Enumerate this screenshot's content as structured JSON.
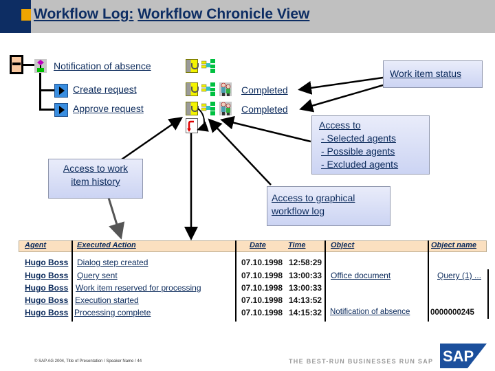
{
  "header": {
    "title_part1": "Workflow Log:",
    "title_part2": "Workflow Chronicle View"
  },
  "tree": {
    "root": {
      "label": "Notification of absence",
      "icons": [
        "status-icon",
        "graph-icon"
      ]
    },
    "children": [
      {
        "label": "Create request",
        "status": "Completed",
        "icons": [
          "status-icon",
          "graph-icon",
          "agents-icon"
        ]
      },
      {
        "label": "Approve request",
        "status": "Completed",
        "icons": [
          "status-icon",
          "graph-icon",
          "agents-icon"
        ]
      }
    ]
  },
  "callouts": {
    "work_item_status": "Work item status",
    "access_agents": {
      "title": "Access to",
      "lines": [
        "- Selected agents",
        "- Possible agents",
        "- Excluded agents"
      ]
    },
    "work_item_history": [
      "Access to work",
      "item history"
    ],
    "graphical_log": [
      "Access to graphical",
      "workflow log"
    ]
  },
  "table": {
    "columns": [
      "Agent",
      "Executed Action",
      "Date",
      "Time",
      "Object",
      "Object name"
    ],
    "rows": [
      {
        "agent": "Hugo Boss",
        "action": "Dialog step created",
        "date": "07.10.1998",
        "time": "12:58:29",
        "object": "",
        "object_name": ""
      },
      {
        "agent": "Hugo Boss",
        "action": "Query sent",
        "date": "07.10.1998",
        "time": "13:00:33",
        "object": "Office document",
        "object_name": "Query (1) ..."
      },
      {
        "agent": "Hugo Boss",
        "action": "Work item reserved for processing",
        "date": "07.10.1998",
        "time": "13:00:33",
        "object": "",
        "object_name": ""
      },
      {
        "agent": "Hugo Boss",
        "action": "Execution started",
        "date": "07.10.1998",
        "time": "14:13:52",
        "object": "",
        "object_name": ""
      },
      {
        "agent": "Hugo Boss",
        "action": "Processing complete",
        "date": "07.10.1998",
        "time": "14:15:32",
        "object": "Notification of absence",
        "object_name": "0000000245"
      }
    ]
  },
  "footer": {
    "note": "© SAP AG 2004, Title of Presentation / Speaker Name / 44",
    "slogan": "THE BEST-RUN BUSINESSES RUN SAP",
    "logo_text": "SAP"
  },
  "colors": {
    "header_bg": "#c0c0c0",
    "header_bar": "#0d2d63",
    "accent": "#f0a500",
    "text": "#0b2a5b",
    "table_header_bg": "#fbe0c0"
  }
}
